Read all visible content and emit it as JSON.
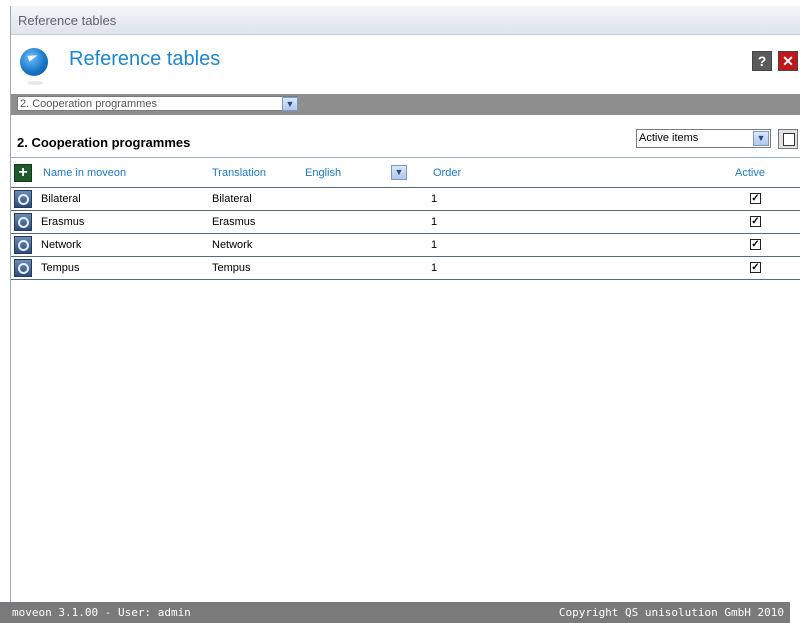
{
  "window": {
    "title": "Reference tables"
  },
  "header": {
    "title": "Reference tables",
    "help_label": "?",
    "close_label": "✕"
  },
  "table_selector": {
    "value": "2. Cooperation programmes",
    "arrow": "▼"
  },
  "section": {
    "title": "2. Cooperation programmes"
  },
  "filter": {
    "value": "Active items",
    "arrow": "▼"
  },
  "table": {
    "add_label": "+",
    "columns": {
      "name": "Name in moveon",
      "translation": "Translation",
      "language": "English",
      "language_arrow": "▼",
      "order": "Order",
      "active": "Active"
    },
    "rows": [
      {
        "name": "Bilateral",
        "translation": "Bilateral",
        "order": "1",
        "active": "✓"
      },
      {
        "name": "Erasmus",
        "translation": "Erasmus",
        "order": "1",
        "active": "✓"
      },
      {
        "name": "Network",
        "translation": "Network",
        "order": "1",
        "active": "✓"
      },
      {
        "name": "Tempus",
        "translation": "Tempus",
        "order": "1",
        "active": "✓"
      }
    ]
  },
  "footer": {
    "left": "moveon 3.1.00 - User: admin",
    "right": "Copyright QS unisolution GmbH 2010"
  },
  "colors": {
    "accent": "#1a88d0",
    "bar": "#8e8e8e",
    "close": "#c01818"
  }
}
